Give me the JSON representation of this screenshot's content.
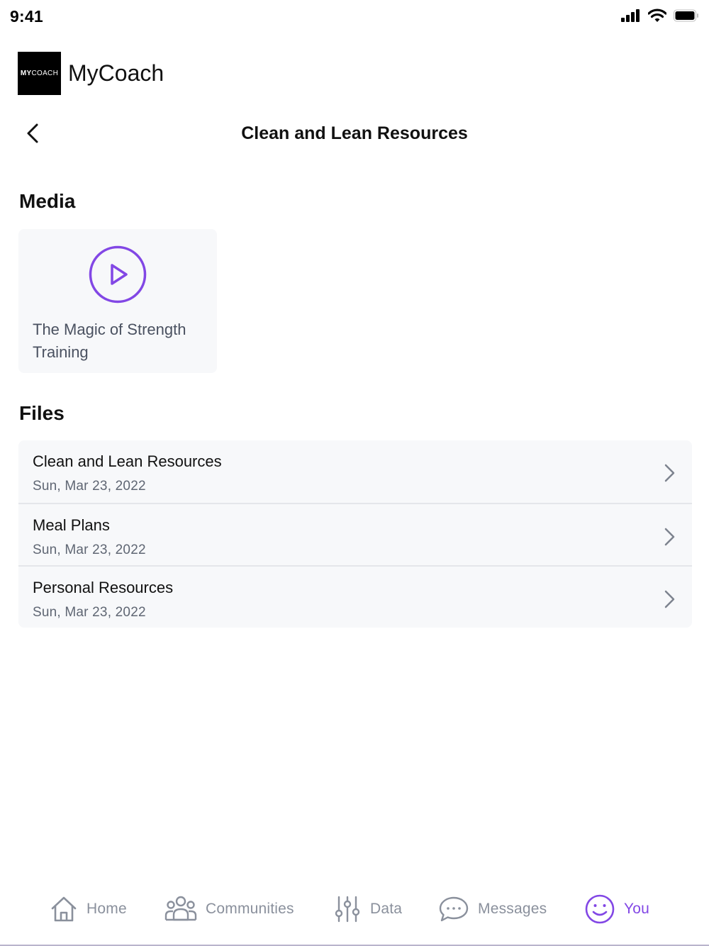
{
  "status_bar": {
    "time": "9:41",
    "icons": [
      "signal-icon",
      "wifi-icon",
      "battery-icon"
    ]
  },
  "brand": {
    "logo_bold": "MY",
    "logo_light": "COACH",
    "name": "MyCoach"
  },
  "header": {
    "back_icon": "chevron-left-icon",
    "title": "Clean and Lean Resources"
  },
  "media": {
    "section_title": "Media",
    "items": [
      {
        "title": "The Magic of Strength Training",
        "icon": "play-circle-icon"
      }
    ]
  },
  "files": {
    "section_title": "Files",
    "items": [
      {
        "name": "Clean and Lean Resources",
        "date": "Sun, Mar 23, 2022"
      },
      {
        "name": "Meal Plans",
        "date": "Sun, Mar 23, 2022"
      },
      {
        "name": "Personal Resources",
        "date": "Sun, Mar 23, 2022"
      }
    ]
  },
  "tabs": [
    {
      "label": "Home",
      "icon": "home-icon",
      "active": false
    },
    {
      "label": "Communities",
      "icon": "people-icon",
      "active": false
    },
    {
      "label": "Data",
      "icon": "sliders-icon",
      "active": false
    },
    {
      "label": "Messages",
      "icon": "chat-bubble-icon",
      "active": false
    },
    {
      "label": "You",
      "icon": "smiley-icon",
      "active": true
    }
  ],
  "colors": {
    "accent": "#8247e5",
    "inactive": "#8a909c",
    "card_bg": "#f7f8fa",
    "divider": "#e4e6ea"
  }
}
